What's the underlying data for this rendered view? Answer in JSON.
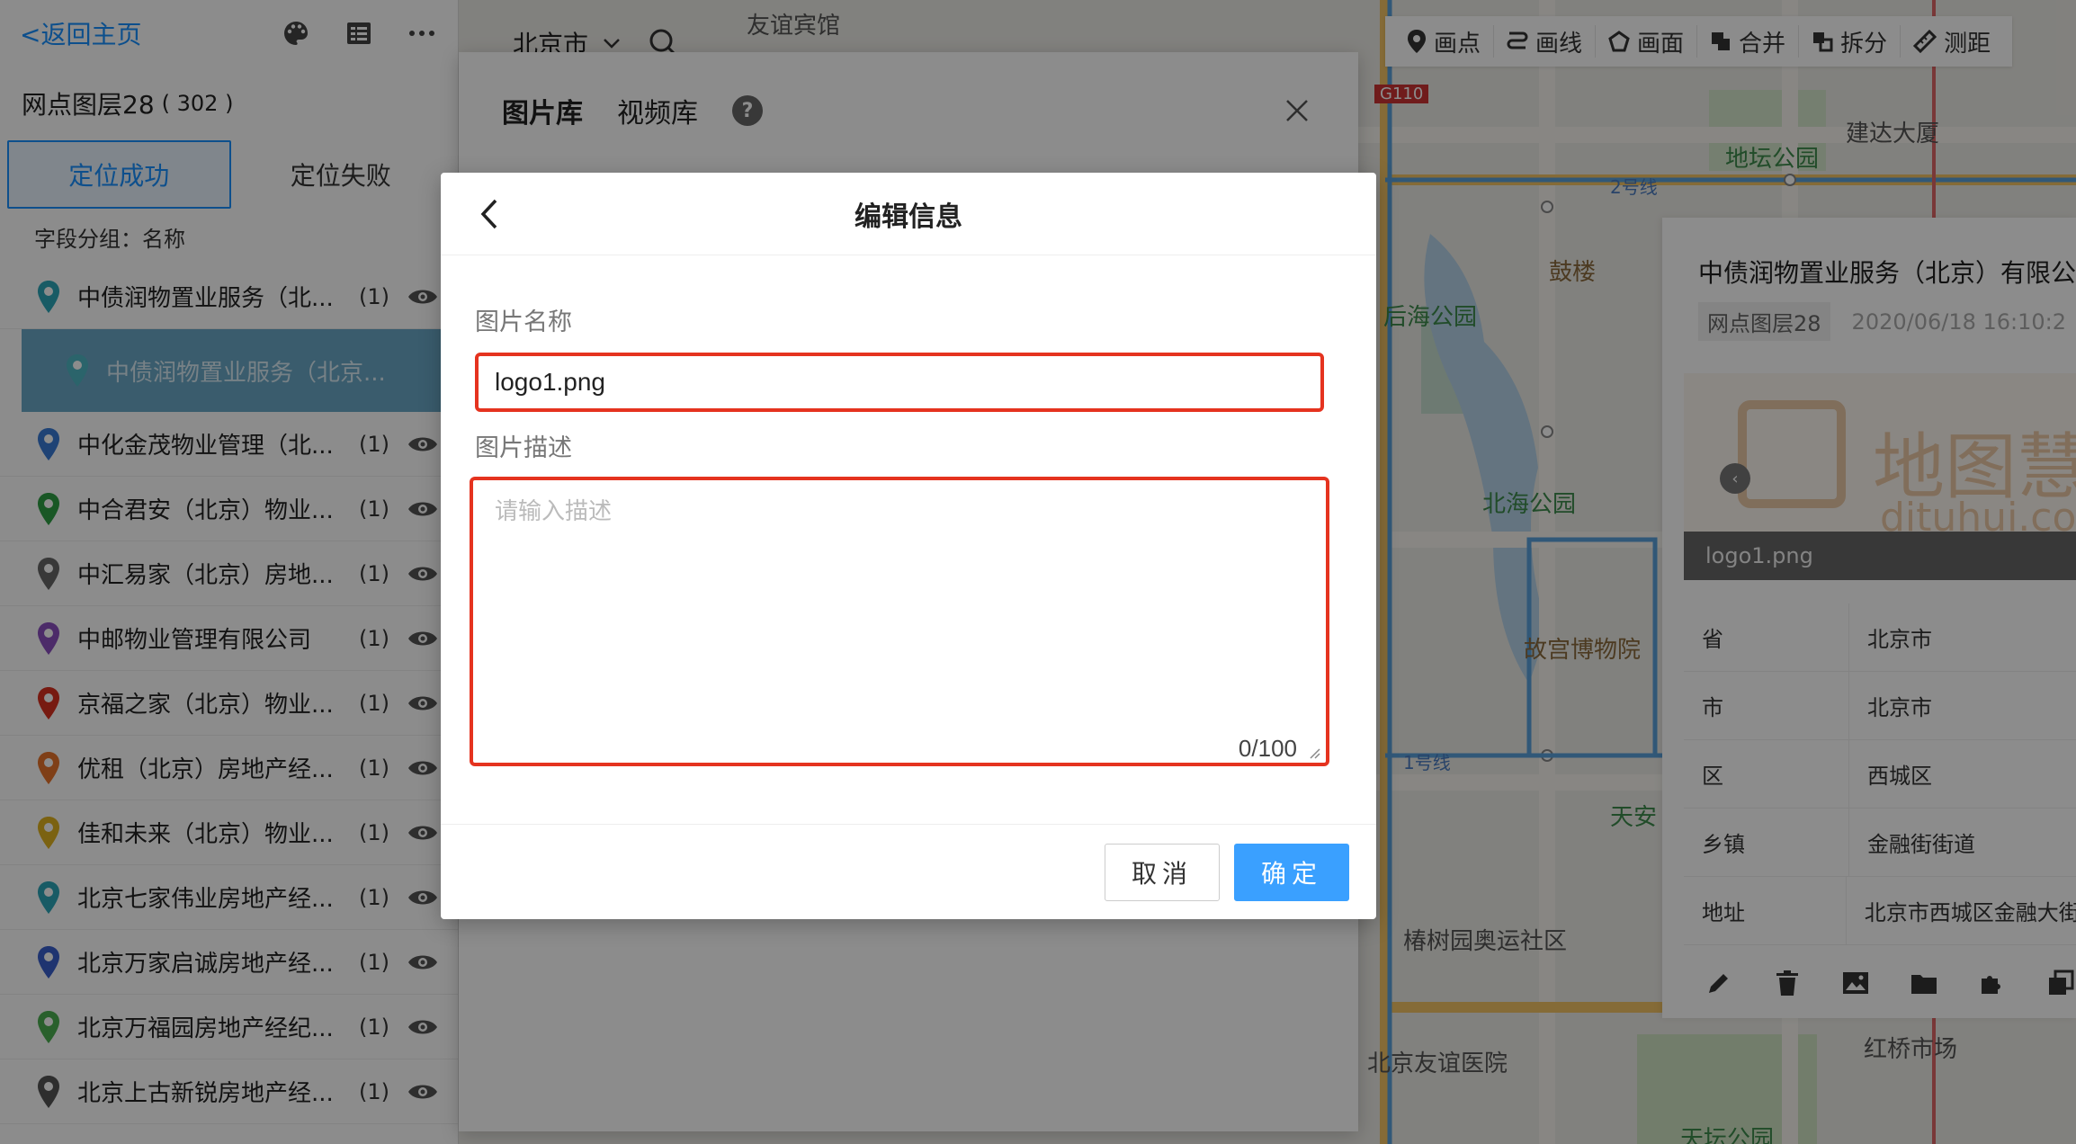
{
  "left_panel": {
    "back_label": "<返回主页",
    "layer_title": "网点图层28",
    "layer_count": "( 302 )",
    "tabs": [
      {
        "label": "定位成功"
      },
      {
        "label": "定位失败"
      }
    ],
    "group_label": "字段分组：名称",
    "items": [
      {
        "name": "中债润物置业服务（北...",
        "count": "(1)",
        "color": "#2ca6b8"
      },
      {
        "name": "中债润物置业服务（北京...",
        "count": "",
        "color": "#2ca6b8"
      },
      {
        "name": "中化金茂物业管理（北...",
        "count": "(1)",
        "color": "#3a7bd5"
      },
      {
        "name": "中合君安（北京）物业...",
        "count": "(1)",
        "color": "#2f9e44"
      },
      {
        "name": "中汇易家（北京）房地...",
        "count": "(1)",
        "color": "#666666"
      },
      {
        "name": "中邮物业管理有限公司",
        "count": "(1)",
        "color": "#8a4fbf"
      },
      {
        "name": "京福之家（北京）物业...",
        "count": "(1)",
        "color": "#d9301f"
      },
      {
        "name": "优租（北京）房地产经...",
        "count": "(1)",
        "color": "#e8742a"
      },
      {
        "name": "佳和未来（北京）物业...",
        "count": "(1)",
        "color": "#e0b21f"
      },
      {
        "name": "北京七家伟业房地产经...",
        "count": "(1)",
        "color": "#2ca6b8"
      },
      {
        "name": "北京万家启诚房地产经...",
        "count": "(1)",
        "color": "#3a5fcd"
      },
      {
        "name": "北京万福园房地产经纪...",
        "count": "(1)",
        "color": "#4caf50"
      },
      {
        "name": "北京上古新锐房地产经...",
        "count": "(1)",
        "color": "#555555"
      }
    ]
  },
  "map": {
    "city": "北京市",
    "labels": [
      {
        "text": "友谊宾馆",
        "cls": ""
      },
      {
        "text": "地坛公园",
        "cls": "green"
      },
      {
        "text": "建达大厦",
        "cls": ""
      },
      {
        "text": "后海公园",
        "cls": "green"
      },
      {
        "text": "鼓楼",
        "cls": "brown"
      },
      {
        "text": "北海公园",
        "cls": "green"
      },
      {
        "text": "故宫博物院",
        "cls": "brown"
      },
      {
        "text": "天安",
        "cls": "green"
      },
      {
        "text": "椿树园奥运社区",
        "cls": ""
      },
      {
        "text": "北京友谊医院",
        "cls": ""
      },
      {
        "text": "红桥市场",
        "cls": ""
      },
      {
        "text": "天坛公园",
        "cls": "green"
      },
      {
        "text": "2号线",
        "cls": "blue"
      },
      {
        "text": "1号线",
        "cls": "blue"
      },
      {
        "text": "G110",
        "cls": ""
      }
    ],
    "toolbar": [
      {
        "label": "画点",
        "icon": "pin-icon"
      },
      {
        "label": "画线",
        "icon": "line-icon"
      },
      {
        "label": "画面",
        "icon": "polygon-icon"
      },
      {
        "label": "合并",
        "icon": "merge-icon"
      },
      {
        "label": "拆分",
        "icon": "split-icon"
      },
      {
        "label": "测距",
        "icon": "ruler-icon"
      }
    ]
  },
  "info_panel": {
    "title": "中债润物置业服务（北京）有限公",
    "layer_tag": "网点图层28",
    "date": "2020/06/18 16:10:2",
    "photo": {
      "logo_text": "地图慧",
      "logo_sub": "dituhui.co",
      "caption": "logo1.png"
    },
    "rows": [
      {
        "k": "省",
        "v": "北京市"
      },
      {
        "k": "市",
        "v": "北京市"
      },
      {
        "k": "区",
        "v": "西城区"
      },
      {
        "k": "乡镇",
        "v": "金融街街道"
      },
      {
        "k": "地址",
        "v": "北京市西城区金融大街"
      }
    ]
  },
  "media_dialog": {
    "tabs": [
      {
        "label": "图片库",
        "active": true
      },
      {
        "label": "视频库",
        "active": false
      }
    ],
    "help_glyph": "?"
  },
  "edit_dialog": {
    "title": "编辑信息",
    "name_label": "图片名称",
    "name_value": "logo1.png",
    "desc_label": "图片描述",
    "desc_placeholder": "请输入描述",
    "counter": "0/100",
    "cancel_label": "取消",
    "ok_label": "确定"
  },
  "colors": {
    "primary": "#1890ff",
    "ok_button": "#3aa0ff",
    "highlight_border": "#e5331f"
  }
}
